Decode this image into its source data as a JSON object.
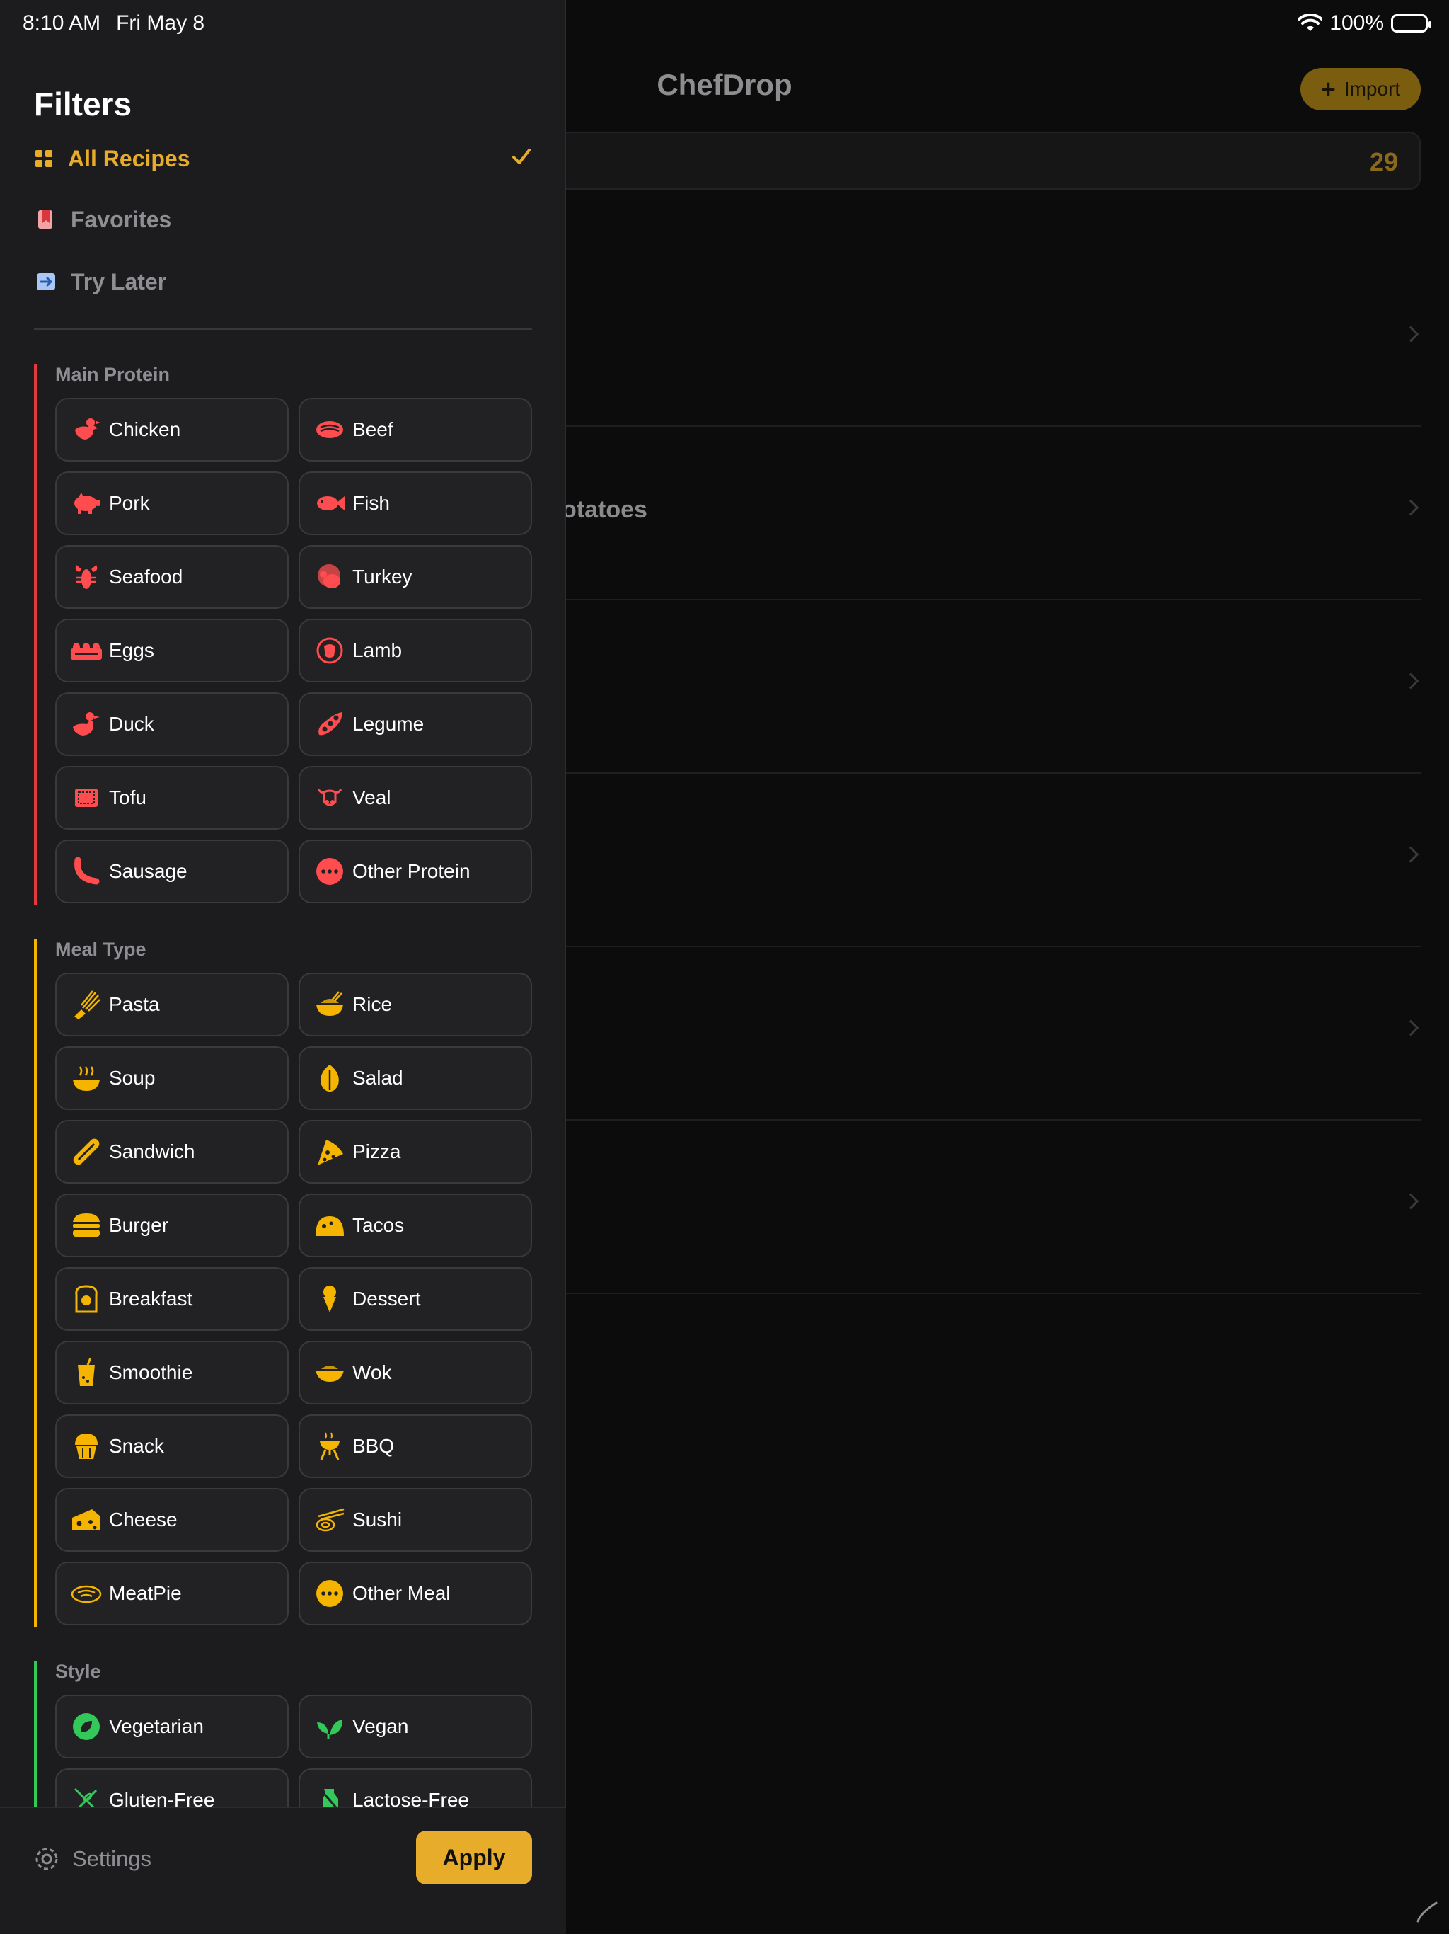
{
  "status_bar": {
    "time": "8:10 AM",
    "date": "Fri May 8",
    "battery": "100%"
  },
  "background": {
    "title": "ChefDrop",
    "import_label": "Import",
    "search_count": "29",
    "partial_row_text": "otatoes"
  },
  "filters": {
    "title": "Filters",
    "nav": [
      {
        "label": "All Recipes",
        "icon": "grid-icon",
        "selected": true
      },
      {
        "label": "Favorites",
        "icon": "bookmark-icon",
        "selected": false
      },
      {
        "label": "Try Later",
        "icon": "try-later-icon",
        "selected": false
      }
    ],
    "sections": [
      {
        "title": "Main Protein",
        "color": "#e0393e",
        "items": [
          "Chicken",
          "Beef",
          "Pork",
          "Fish",
          "Seafood",
          "Turkey",
          "Eggs",
          "Lamb",
          "Duck",
          "Legume",
          "Tofu",
          "Veal",
          "Sausage",
          "Other Protein"
        ]
      },
      {
        "title": "Meal Type",
        "color": "#f4b400",
        "items": [
          "Pasta",
          "Rice",
          "Soup",
          "Salad",
          "Sandwich",
          "Pizza",
          "Burger",
          "Tacos",
          "Breakfast",
          "Dessert",
          "Smoothie",
          "Wok",
          "Snack",
          "BBQ",
          "Cheese",
          "Sushi",
          "MeatPie",
          "Other Meal"
        ]
      },
      {
        "title": "Style",
        "color": "#34c759",
        "items": [
          "Vegetarian",
          "Vegan",
          "Gluten-Free",
          "Lactose-Free"
        ]
      }
    ]
  },
  "footer": {
    "settings_label": "Settings",
    "apply_label": "Apply"
  }
}
